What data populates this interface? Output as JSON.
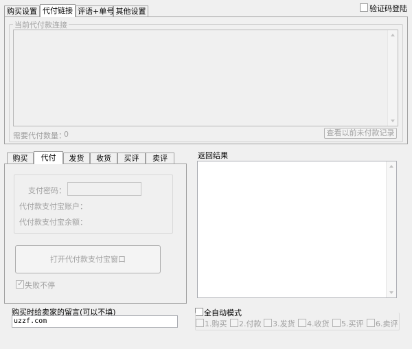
{
  "top_tabs": [
    "购买设置",
    "代付链接",
    "评语+单号",
    "其他设置"
  ],
  "top_active_tab": 1,
  "captcha_login_label": "验证码登陆",
  "link_group_label": "当前代付款连接",
  "need_count_label": "需要代付数量：",
  "need_count_value": "0",
  "view_unpaid_button": "查看以前未付款记录",
  "bottom_tabs": [
    "购买",
    "代付",
    "发货",
    "收货",
    "买评",
    "卖评"
  ],
  "bottom_active_tab": 1,
  "pay_password_label": "支付密码：",
  "alipay_account_label": "代付款支付宝账户：",
  "alipay_balance_label": "代付款支付宝余额：",
  "open_alipay_button": "打开代付款支付宝窗口",
  "fail_continue_label": "失败不停",
  "result_label": "返回结果",
  "message_label": "购买时给卖家的留言(可以不填)",
  "message_value": "uzzf.com",
  "auto_mode_label": "全自动模式",
  "steps": [
    "1.购买",
    "2.付款",
    "3.发货",
    "4.收货",
    "5.买评",
    "6.卖评"
  ]
}
